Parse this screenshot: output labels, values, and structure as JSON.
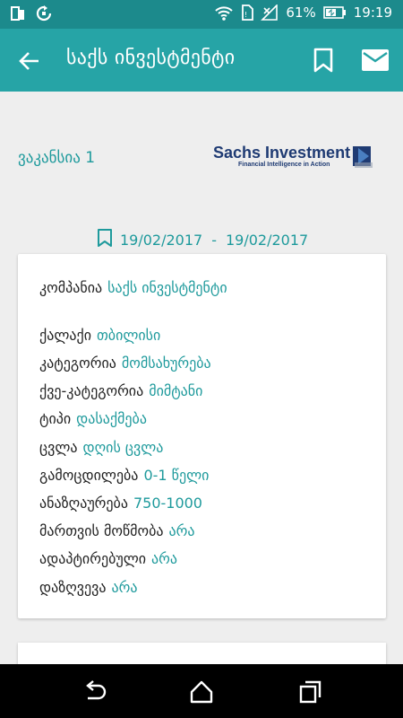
{
  "status_bar": {
    "battery_percent": "61%",
    "time": "19:19"
  },
  "app_bar": {
    "title": "საქს ინვესტმენტი",
    "back_icon": "arrow-back-icon",
    "bookmark_icon": "bookmark-icon",
    "mail_icon": "mail-icon"
  },
  "vacancy": {
    "label": "ვაკანსია 1"
  },
  "logo": {
    "brand": "Sachs Investment",
    "tagline": "Financial Intelligence in Action"
  },
  "dates": {
    "start": "19/02/2017",
    "separator": "-",
    "end": "19/02/2017"
  },
  "details": [
    {
      "label": "კომპანია",
      "value": "საქს ინვესტმენტი"
    },
    {
      "label": "ქალაქი",
      "value": "თბილისი"
    },
    {
      "label": "კატეგორია",
      "value": "მომსახურება"
    },
    {
      "label": "ქვე-კატეგორია",
      "value": "მიმტანი"
    },
    {
      "label": "ტიპი",
      "value": "დასაქმება"
    },
    {
      "label": "ცვლა",
      "value": "დღის ცვლა"
    },
    {
      "label": "გამოცდილება",
      "value": "0-1 წელი"
    },
    {
      "label": "ანაზღაურება",
      "value": "750-1000"
    },
    {
      "label": "მართვის მოწმობა",
      "value": "არა"
    },
    {
      "label": "ადაპტირებული",
      "value": "არა"
    },
    {
      "label": "დაზღვევა",
      "value": "არა"
    }
  ],
  "colors": {
    "status_bar": "#1c8a8c",
    "app_bar": "#26a4a6",
    "accent_text": "#1e9a9c"
  }
}
